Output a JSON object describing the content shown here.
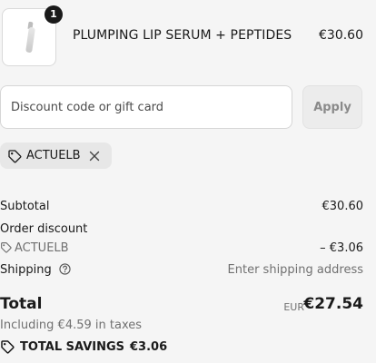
{
  "product": {
    "quantity": "1",
    "name": "PLUMPING LIP SERUM + PEPTIDES",
    "price": "€30.60",
    "image_icon": "lip-serum-tube"
  },
  "discount": {
    "placeholder": "Discount code or gift card",
    "value": "",
    "apply_label": "Apply"
  },
  "applied_code": {
    "code": "ACTUELB",
    "tag_icon": "tag-icon",
    "remove_icon": "close-icon"
  },
  "summary": {
    "subtotal_label": "Subtotal",
    "subtotal_value": "€30.60",
    "order_discount_label": "Order discount",
    "order_discount_code": "ACTUELB",
    "order_discount_value": "– €3.06",
    "shipping_label": "Shipping",
    "shipping_value": "Enter shipping address"
  },
  "total": {
    "label": "Total",
    "currency": "EUR",
    "amount": "€27.54",
    "taxes_note": "Including €4.59 in taxes"
  },
  "savings": {
    "label": "TOTAL SAVINGS",
    "amount": "€3.06"
  }
}
